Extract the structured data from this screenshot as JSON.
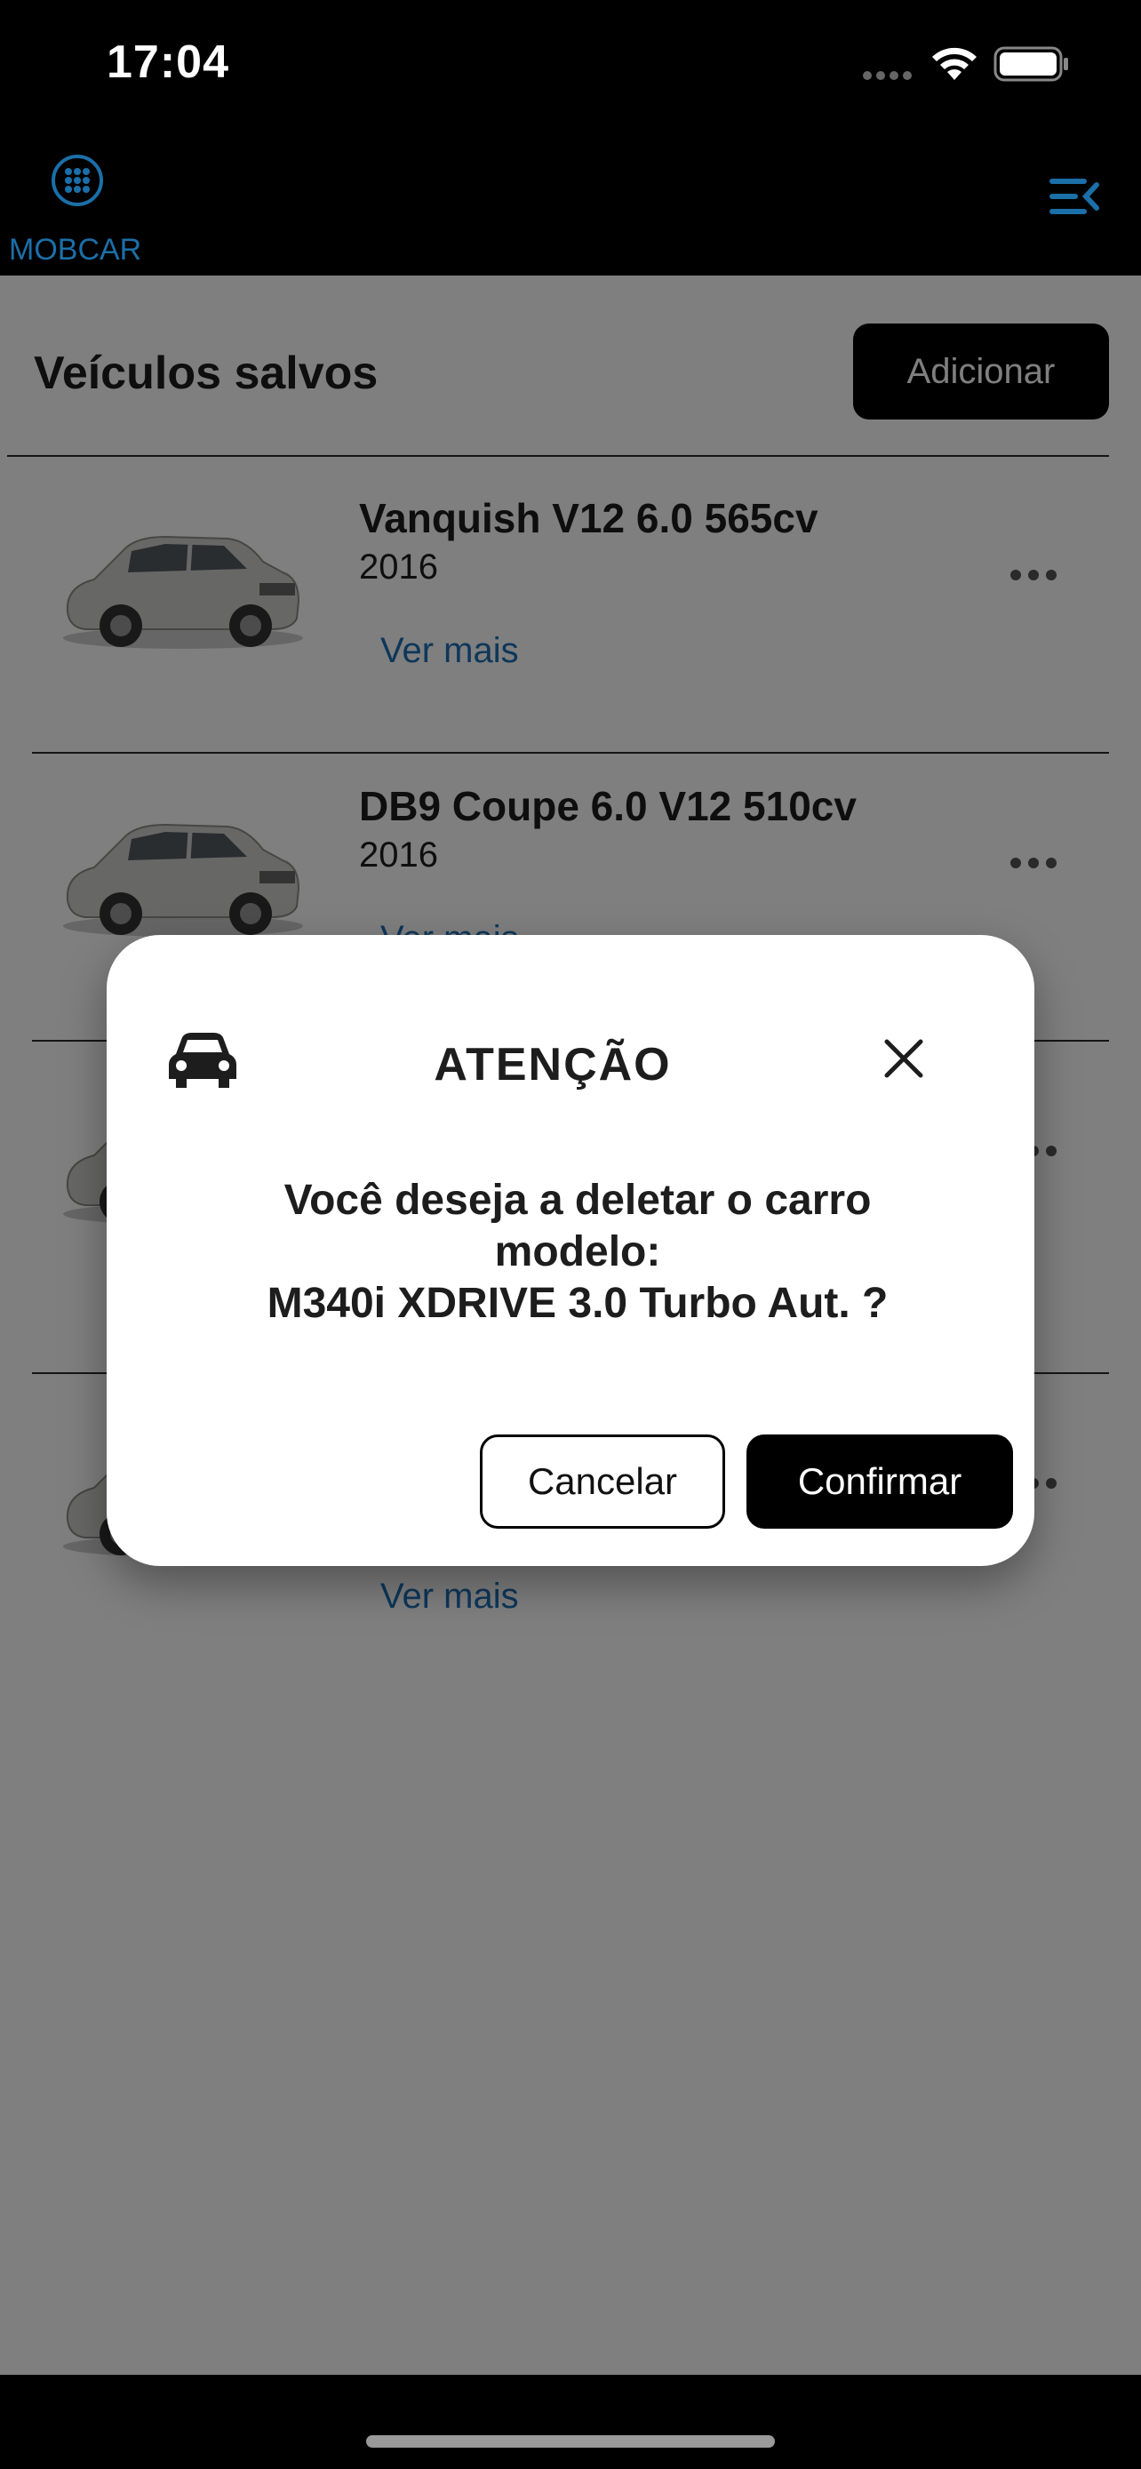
{
  "status_bar": {
    "time": "17:04"
  },
  "header": {
    "brand_name": "MOBCAR",
    "accent_color": "#1b6fa8",
    "logo_icon": "grid-circle-icon",
    "menu_icon": "menu-collapse-icon"
  },
  "page": {
    "title": "Veículos salvos",
    "add_button_label": "Adicionar"
  },
  "vehicles": [
    {
      "name": "Vanquish V12 6.0 565cv",
      "year": "2016",
      "more_label": "Ver mais"
    },
    {
      "name": "DB9 Coupe 6.0 V12 510cv",
      "year": "2016",
      "more_label": "Ver mais"
    },
    {
      "name": "",
      "year": "",
      "more_label": ""
    },
    {
      "name": "",
      "year": "",
      "more_label": "Ver mais"
    }
  ],
  "modal": {
    "title": "ATENÇÃO",
    "message_line1": "Você deseja a deletar o carro",
    "message_line2": "modelo:",
    "message_line3": "M340i XDRIVE 3.0 Turbo Aut. ?",
    "cancel_label": "Cancelar",
    "confirm_label": "Confirmar"
  }
}
